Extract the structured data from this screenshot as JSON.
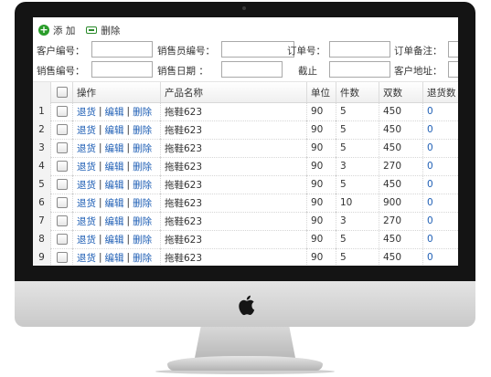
{
  "toolbar": {
    "add_label": "添 加",
    "delete_label": "删除"
  },
  "filters": {
    "customer_no": "客户编号：",
    "salesperson_no": "销售员编号：",
    "order_no": "订单号：",
    "order_note": "订单备注：",
    "sales_no": "销售编号：",
    "sales_date": "销售日期 ：",
    "until": "截止",
    "customer_address": "客户地址："
  },
  "table": {
    "columns": [
      "操作",
      "产品名称",
      "单位",
      "件数",
      "双数",
      "退货数"
    ],
    "action_labels": {
      "return": "退货",
      "edit": "编辑",
      "delete": "删除",
      "separator": "|"
    },
    "rows": [
      {
        "num": "1",
        "product": "拖鞋623",
        "unit": "90",
        "pieces": "5",
        "pairs": "450",
        "returns": "0"
      },
      {
        "num": "2",
        "product": "拖鞋623",
        "unit": "90",
        "pieces": "5",
        "pairs": "450",
        "returns": "0"
      },
      {
        "num": "3",
        "product": "拖鞋623",
        "unit": "90",
        "pieces": "5",
        "pairs": "450",
        "returns": "0"
      },
      {
        "num": "4",
        "product": "拖鞋623",
        "unit": "90",
        "pieces": "3",
        "pairs": "270",
        "returns": "0"
      },
      {
        "num": "5",
        "product": "拖鞋623",
        "unit": "90",
        "pieces": "5",
        "pairs": "450",
        "returns": "0"
      },
      {
        "num": "6",
        "product": "拖鞋623",
        "unit": "90",
        "pieces": "10",
        "pairs": "900",
        "returns": "0"
      },
      {
        "num": "7",
        "product": "拖鞋623",
        "unit": "90",
        "pieces": "3",
        "pairs": "270",
        "returns": "0"
      },
      {
        "num": "8",
        "product": "拖鞋623",
        "unit": "90",
        "pieces": "5",
        "pairs": "450",
        "returns": "0"
      },
      {
        "num": "9",
        "product": "拖鞋623",
        "unit": "90",
        "pieces": "5",
        "pairs": "450",
        "returns": "0"
      }
    ]
  },
  "icons": {
    "add": "plus-circle-icon",
    "delete": "minus-box-icon",
    "brand": "apple-logo-icon"
  },
  "colors": {
    "link": "#1f5fb5",
    "add_icon": "#2a9d2a"
  }
}
